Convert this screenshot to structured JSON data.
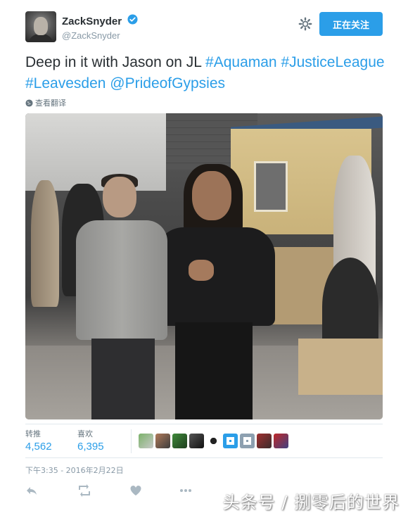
{
  "header": {
    "display_name": "ZackSnyder",
    "handle": "@ZackSnyder",
    "follow_label": "正在关注"
  },
  "tweet": {
    "plain_text": "Deep in it with Jason on JL ",
    "hashtags": [
      "#Aquaman",
      "#JusticeLeague",
      "#Leavesden"
    ],
    "mention": "@PrideofGypsies",
    "translate_label": "查看翻译"
  },
  "stats": {
    "retweets_label": "转推",
    "retweets_value": "4,562",
    "likes_label": "喜欢",
    "likes_value": "6,395"
  },
  "timestamp": "下午3:35 - 2016年2月22日",
  "watermark": "头条号 / 捌零后的世界",
  "colors": {
    "accent": "#2b9ee8",
    "text": "#292f33",
    "muted": "#8899a6"
  },
  "icons": {
    "verified": "verified-icon",
    "settings": "gear-icon",
    "translate": "globe-icon",
    "reply": "reply-icon",
    "retweet": "retweet-icon",
    "like": "heart-icon",
    "more": "more-icon"
  }
}
